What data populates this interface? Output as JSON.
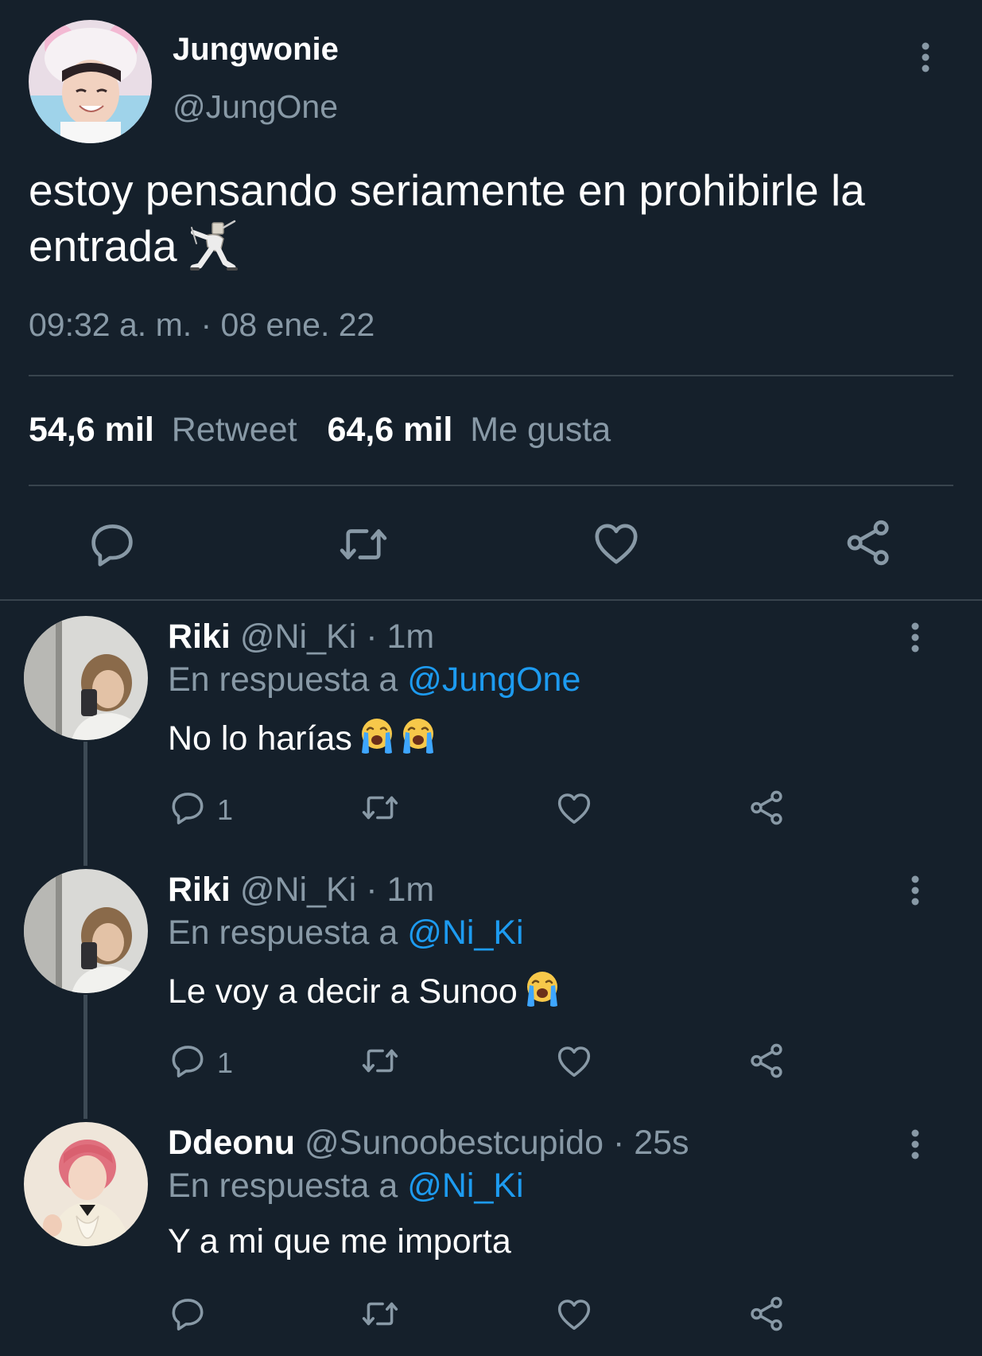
{
  "main_tweet": {
    "author_name": "Jungwonie",
    "author_handle": "@JungOne",
    "text": "estoy pensando seriamente en prohibirle la entrada",
    "emoji": "fencer-emoji",
    "timestamp": "09:32 a. m. · 08 ene. 22",
    "retweet_count": "54,6 mil",
    "retweet_label": "Retweet",
    "like_count": "64,6 mil",
    "like_label": "Me gusta"
  },
  "replies": [
    {
      "name": "Riki",
      "handle": "@Ni_Ki",
      "time": "· 1m",
      "reply_prefix": "En respuesta a",
      "reply_to": "@JungOne",
      "text": "No lo harías",
      "emojis": [
        "loudly-crying-face",
        "loudly-crying-face"
      ],
      "reply_count": "1"
    },
    {
      "name": "Riki",
      "handle": "@Ni_Ki",
      "time": "· 1m",
      "reply_prefix": "En respuesta a",
      "reply_to": "@Ni_Ki",
      "text": "Le voy a decir a Sunoo",
      "emojis": [
        "loudly-crying-face"
      ],
      "reply_count": "1"
    },
    {
      "name": "Ddeonu",
      "handle": "@Sunoobestcupido",
      "time": "· 25s",
      "reply_prefix": "En respuesta a",
      "reply_to": "@Ni_Ki",
      "text": "Y a mi que me importa",
      "emojis": [],
      "reply_count": ""
    }
  ],
  "colors": {
    "background": "#15202b",
    "text": "#ffffff",
    "muted": "#8899a6",
    "link": "#1d9bf0",
    "divider": "#38444d"
  }
}
